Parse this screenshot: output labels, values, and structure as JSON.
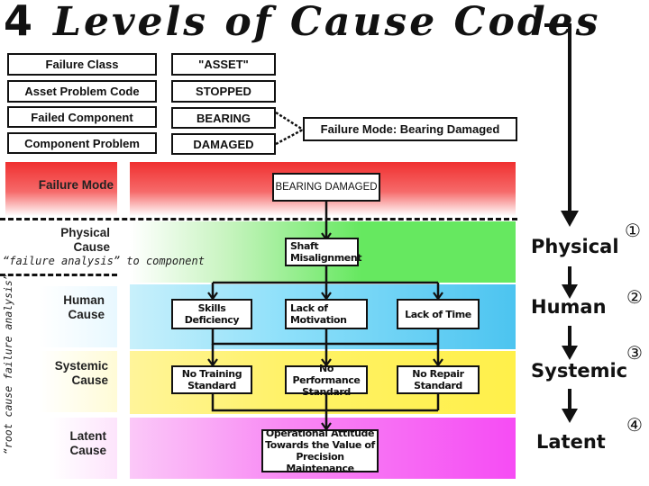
{
  "title": {
    "number": "4",
    "text": "Levels of Cause Codes"
  },
  "code_table": {
    "labels": [
      "Failure Class",
      "Asset Problem Code",
      "Failed Component",
      "Component Problem"
    ],
    "values": [
      "\"ASSET\"",
      "STOPPED",
      "BEARING",
      "DAMAGED"
    ],
    "failure_mode_box": "Failure Mode: Bearing Damaged"
  },
  "bands": [
    {
      "label_line1": "Failure Mode",
      "label_line2": "",
      "color": "#f03030"
    },
    {
      "label_line1": "Physical",
      "label_line2": "Cause",
      "color": "#66e860"
    },
    {
      "label_line1": "Human",
      "label_line2": "Cause",
      "color": "#4cc4f0"
    },
    {
      "label_line1": "Systemic",
      "label_line2": "Cause",
      "color": "#fff04a"
    },
    {
      "label_line1": "Latent",
      "label_line2": "Cause",
      "color": "#f64cf4"
    }
  ],
  "annotations": {
    "failure_analysis": "“failure analysis” to component",
    "root_cause": "“root cause failure analysis”"
  },
  "nodes": {
    "bearing_damaged": "BEARING DAMAGED",
    "shaft_l1": "Shaft",
    "shaft_l2": "Misalignment",
    "skills": "Skills Deficiency",
    "motivation_l1": "Lack of",
    "motivation_l2": "Motivation",
    "time": "Lack of Time",
    "training_l1": "No Training",
    "training_l2": "Standard",
    "performance_l1": "No Performance",
    "performance_l2": "Standard",
    "repair_l1": "No Repair",
    "repair_l2": "Standard",
    "latent_l1": "Operational Attitude",
    "latent_l2": "Towards the Value of",
    "latent_l3": "Precision Maintenance"
  },
  "levels": [
    {
      "name": "Physical",
      "marker": "①"
    },
    {
      "name": "Human",
      "marker": "②"
    },
    {
      "name": "Systemic",
      "marker": "③"
    },
    {
      "name": "Latent",
      "marker": "④"
    }
  ]
}
